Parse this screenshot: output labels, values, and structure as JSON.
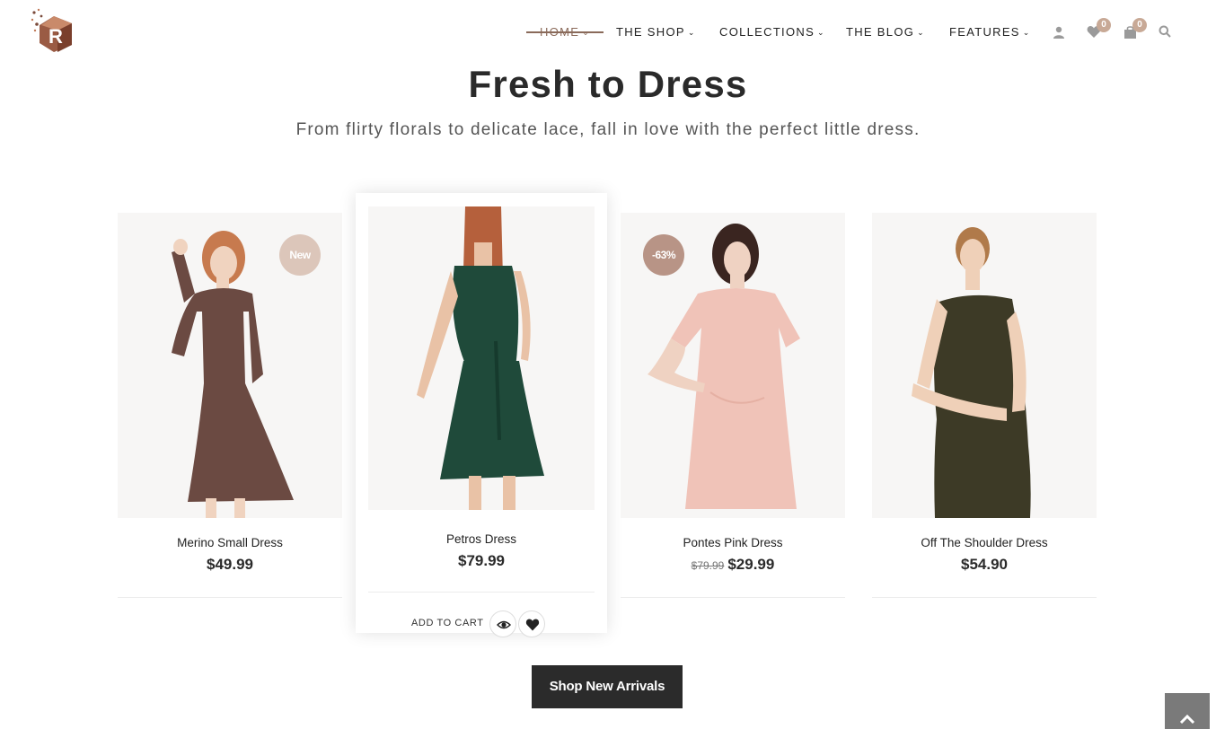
{
  "brand": {
    "logo_letter": "R"
  },
  "nav": {
    "items": [
      {
        "label": "HOME",
        "active": true
      },
      {
        "label": "THE SHOP",
        "active": false
      },
      {
        "label": "COLLECTIONS",
        "active": false
      },
      {
        "label": "THE BLOG",
        "active": false
      },
      {
        "label": "FEATURES",
        "active": false
      }
    ],
    "wishlist_count": "0",
    "cart_count": "0",
    "icons": [
      "user-icon",
      "heart-icon",
      "shopping-bag-icon",
      "search-icon"
    ]
  },
  "section": {
    "title": "Fresh to Dress",
    "subtitle": "From flirty florals to delicate lace, fall in love with the perfect little dress."
  },
  "products": [
    {
      "name": "Merino Small Dress",
      "price": "$49.99",
      "old_price": "",
      "tag": "New",
      "tag_color": "#dcc6ba",
      "dress_color": "#6b4a42"
    },
    {
      "name": "Petros Dress",
      "price": "$79.99",
      "old_price": "",
      "tag": "",
      "dress_color": "#1f4a3a"
    },
    {
      "name": "Pontes Pink Dress",
      "price": "$29.99",
      "old_price": "$79.99",
      "tag": "-63%",
      "tag_color": "#b89486",
      "dress_color": "#f0c3b8"
    },
    {
      "name": "Off The Shoulder Dress",
      "price": "$54.90",
      "old_price": "",
      "tag": "",
      "dress_color": "#3d3a26"
    }
  ],
  "featured_actions": {
    "add_to_cart": "ADD TO CART"
  },
  "cta": {
    "label": "Shop New Arrivals"
  },
  "colors": {
    "accent": "#8a6a5a",
    "badge": "#c8a996",
    "dark": "#2b2b2b"
  }
}
